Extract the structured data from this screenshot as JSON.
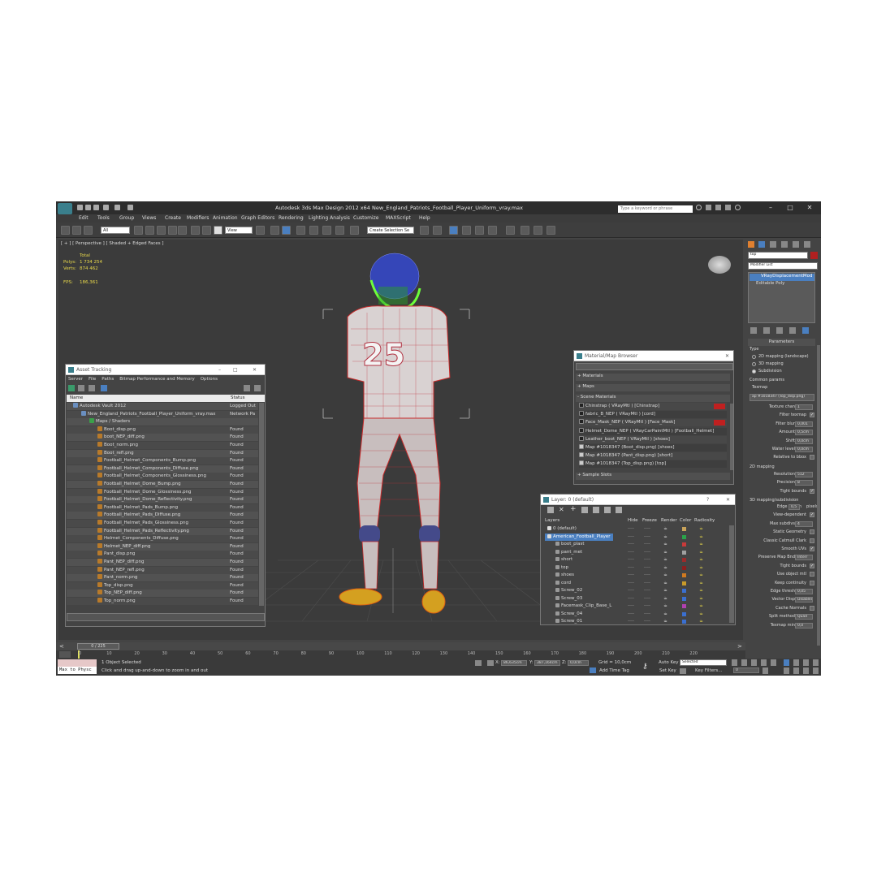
{
  "title_bar": {
    "title": "Autodesk 3ds Max Design 2012 x64      New_England_Patriots_Football_Player_Uniform_vray.max",
    "search_placeholder": "Type a keyword or phrase"
  },
  "menu": [
    "Edit",
    "Tools",
    "Group",
    "Views",
    "Create",
    "Modifiers",
    "Animation",
    "Graph Editors",
    "Rendering",
    "Lighting Analysis",
    "Customize",
    "MAXScript",
    "Help"
  ],
  "toolbar": {
    "filter_value": "All",
    "refcoord_value": "View",
    "selection_set_placeholder": "Create Selection Se"
  },
  "viewport": {
    "label": "[ + ] [ Perspective ] [ Shaded + Edged Faces ]",
    "stats": {
      "total_label": "Total",
      "polys_label": "Polys:",
      "polys": "1 734 254",
      "verts_label": "Verts:",
      "verts": "874 462",
      "fps_label": "FPS:",
      "fps": "186,361"
    },
    "jersey_number": "25"
  },
  "asset_tracking": {
    "title": "Asset Tracking",
    "menu": [
      "Server",
      "File",
      "Paths",
      "Bitmap Performance and Memory",
      "Options"
    ],
    "columns": [
      "Name",
      "Status"
    ],
    "rows": [
      {
        "name": "Autodesk Vault 2012",
        "status": "Logged Out"
      },
      {
        "name": "New_England_Patriots_Football_Player_Uniform_vray.max",
        "status": "Network Pa"
      },
      {
        "name": "Maps / Shaders",
        "status": ""
      },
      {
        "name": "Boot_disp.png",
        "status": "Found"
      },
      {
        "name": "boot_NEP_diff.png",
        "status": "Found"
      },
      {
        "name": "Boot_norm.png",
        "status": "Found"
      },
      {
        "name": "Boot_refl.png",
        "status": "Found"
      },
      {
        "name": "Football_Helmet_Components_Bump.png",
        "status": "Found"
      },
      {
        "name": "Football_Helmet_Components_Diffuse.png",
        "status": "Found"
      },
      {
        "name": "Football_Helmet_Components_Glossiness.png",
        "status": "Found"
      },
      {
        "name": "Football_Helmet_Dome_Bump.png",
        "status": "Found"
      },
      {
        "name": "Football_Helmet_Dome_Glossiness.png",
        "status": "Found"
      },
      {
        "name": "Football_Helmet_Dome_Reflectivity.png",
        "status": "Found"
      },
      {
        "name": "Football_Helmet_Pads_Bump.png",
        "status": "Found"
      },
      {
        "name": "Football_Helmet_Pads_Diffuse.png",
        "status": "Found"
      },
      {
        "name": "Football_Helmet_Pads_Glossiness.png",
        "status": "Found"
      },
      {
        "name": "Football_Helmet_Pads_Reflectivity.png",
        "status": "Found"
      },
      {
        "name": "Helmet_Components_Diffuse.png",
        "status": "Found"
      },
      {
        "name": "Helmet_NEP_diff.png",
        "status": "Found"
      },
      {
        "name": "Pant_disp.png",
        "status": "Found"
      },
      {
        "name": "Pant_NEP_diff.png",
        "status": "Found"
      },
      {
        "name": "Pant_NEP_refl.png",
        "status": "Found"
      },
      {
        "name": "Pant_norm.png",
        "status": "Found"
      },
      {
        "name": "Top_disp.png",
        "status": "Found"
      },
      {
        "name": "Top_NEP_diff.png",
        "status": "Found"
      },
      {
        "name": "Top_norm.png",
        "status": "Found"
      }
    ]
  },
  "material_browser": {
    "title": "Material/Map Browser",
    "sections": [
      "+ Materials",
      "+ Maps",
      "- Scene Materials",
      "+ Sample Slots"
    ],
    "items": [
      "Chinstrap  ( VRayMtl )  [Chinstrap]",
      "fabric_B_NEP  ( VRayMtl )  [cord]",
      "Face_Mask_NEP  ( VRayMtl )  [Face_Mask]",
      "Helmet_Dome_NEP  ( VRayCarPaintMtl )  [Football_Helmet]",
      "Leather_boot_NEP  ( VRayMtl )  [shoes]",
      "Map #1018347 (Boot_disp.png) [shoes]",
      "Map #1018347 (Pant_disp.png) [short]",
      "Map #1018347 (Top_disp.png) [top]"
    ]
  },
  "layer_manager": {
    "title": "Layer: 0 (default)",
    "columns": [
      "Layers",
      "Hide",
      "Freeze",
      "Render",
      "Color",
      "Radiosity"
    ],
    "rows": [
      {
        "name": "0 (default)",
        "color": "#c9a35a"
      },
      {
        "name": "American_Football_Player",
        "color": "#2aa24a"
      },
      {
        "name": "boot_plast",
        "color": "#c83a3a"
      },
      {
        "name": "pant_met",
        "color": "#a0a0a0"
      },
      {
        "name": "short",
        "color": "#9a2b2b"
      },
      {
        "name": "top",
        "color": "#8b1f1f"
      },
      {
        "name": "shoes",
        "color": "#d07a20"
      },
      {
        "name": "cord",
        "color": "#c89a2a"
      },
      {
        "name": "Screw_02",
        "color": "#3a6fd0"
      },
      {
        "name": "Screw_03",
        "color": "#3a6fd0"
      },
      {
        "name": "Facemask_Clip_Base_L",
        "color": "#b040b0"
      },
      {
        "name": "Screw_04",
        "color": "#3a6fd0"
      },
      {
        "name": "Screw_01",
        "color": "#3a6fd0"
      }
    ],
    "dash": "----"
  },
  "command_panel": {
    "search_value": "top",
    "modifier_list": "Modifier List",
    "stack": [
      "VRayDisplacementMod",
      "Editable Poly"
    ],
    "parameters": "Parameters",
    "type_label": "Type",
    "type_options": [
      "2D mapping (landscape)",
      "3D mapping",
      "Subdivision"
    ],
    "common_params": "Common params",
    "texmap_label": "Texmap",
    "texmap_value": "ap #1018347 (Top_disp.png)",
    "fields": [
      {
        "label": "Texture chan",
        "value": "1"
      },
      {
        "label": "Filter texmap",
        "value": "✓"
      },
      {
        "label": "Filter blur",
        "value": "0,001"
      },
      {
        "label": "Amount",
        "value": "0,5cm"
      },
      {
        "label": "Shift",
        "value": "0,0cm"
      },
      {
        "label": "Water level",
        "value": "0,0cm"
      },
      {
        "label": "Relative to bbox",
        "value": ""
      }
    ],
    "mapping2d": "2D mapping",
    "mapping2d_fields": [
      {
        "label": "Resolution",
        "value": "512"
      },
      {
        "label": "Precision",
        "value": "8"
      },
      {
        "label": "Tight bounds",
        "value": "✓"
      }
    ],
    "subdiv": "3D mapping/subdivision",
    "subdiv_fields": [
      {
        "label": "Edge length",
        "value": "0,5"
      },
      {
        "label": "View-dependent",
        "value": "✓"
      },
      {
        "label": "Max subdivs",
        "value": "4"
      },
      {
        "label": "Static Geometry",
        "value": ""
      },
      {
        "label": "Classic Catmull Clark",
        "value": ""
      },
      {
        "label": "Smooth UVs",
        "value": "✓"
      },
      {
        "label": "Preserve Map Bnd",
        "value": "Interr"
      },
      {
        "label": "Tight bounds",
        "value": "✓"
      },
      {
        "label": "Use object mtl",
        "value": ""
      },
      {
        "label": "Keep continuity",
        "value": ""
      },
      {
        "label": "Edge thresh",
        "value": "0,05"
      },
      {
        "label": "Vector Disp",
        "value": "Disabled"
      },
      {
        "label": "Cache Normals",
        "value": ""
      },
      {
        "label": "Split method",
        "value": "Quad"
      },
      {
        "label": "Texmap min",
        "value": "0,0"
      }
    ],
    "pixels": "pixels"
  },
  "timeline": {
    "slider": "0 / 225",
    "ticks": [
      "0",
      "10",
      "20",
      "30",
      "40",
      "50",
      "60",
      "70",
      "80",
      "90",
      "100",
      "110",
      "120",
      "130",
      "140",
      "150",
      "160",
      "170",
      "180",
      "190",
      "200",
      "210",
      "220"
    ]
  },
  "status_bar": {
    "maxscript": "Max to Physc",
    "selected": "1 Object Selected",
    "hint": "Click and drag up-and-down to zoom in and out",
    "x": "86,635cm",
    "y": "387,164cm",
    "z": "0,0cm",
    "grid": "Grid = 10,0cm",
    "auto_key": "Auto Key",
    "selected_dd": "Selected",
    "set_key": "Set Key",
    "key_filters": "Key Filters...",
    "add_time_tag": "Add Time Tag",
    "frame": "0"
  }
}
